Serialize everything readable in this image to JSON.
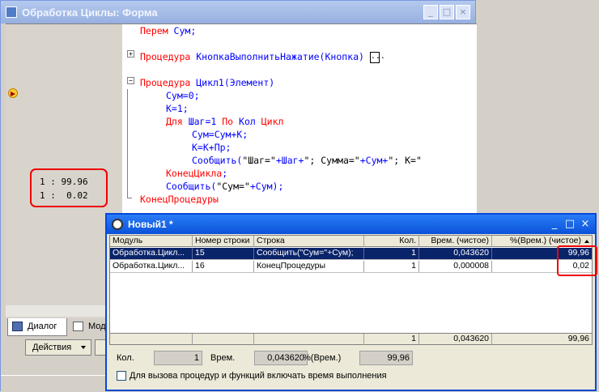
{
  "main_window": {
    "title": "Обработка Циклы: Форма",
    "buttons": {
      "minimize": "_",
      "maximize": "□",
      "close": "×"
    }
  },
  "code": {
    "l1": {
      "kw": "Перем",
      "rest": " Сум;"
    },
    "l2": {
      "kw": "Процедура",
      "rest": " КнопкаВыполнитьНажатие(Кнопка) ",
      "dots": "..."
    },
    "l3": {
      "kw": "Процедура",
      "rest": " Цикл1(Элемент)"
    },
    "l4": "Сум=0;",
    "l5": "К=1;",
    "l6": {
      "kw1": "Для",
      "mid1": " Шаг=1 ",
      "kw2": "По",
      "mid2": " Кол ",
      "kw3": "Цикл"
    },
    "l7": "Сум=Сум+К;",
    "l8": "К=К+Пр;",
    "l9": {
      "fn": "Сообщить(",
      "s1": "\"Шаг=\"",
      "a1": "+Шаг+",
      "s2": "\"; Сумма=\"",
      "a2": "+Сум+",
      "s3": "\"; К=\""
    },
    "l10": {
      "kw": "КонецЦикла",
      "rest": ";"
    },
    "l11": {
      "fn": "Сообщить(",
      "s1": "\"Сум=\"",
      "rest": "+Сум);"
    },
    "l12": {
      "kw": "КонецПроцедуры"
    }
  },
  "result_values": {
    "line1": "1 : 99.96",
    "line2": "1 :  0.02"
  },
  "tabs": {
    "dialog": "Диалог",
    "module": "Модуль"
  },
  "actions_button": "Действия",
  "profile_window": {
    "title": "Новый1 *",
    "buttons": {
      "minimize": "_",
      "maximize": "□",
      "close": "×"
    },
    "columns": [
      "Модуль",
      "Номер строки",
      "Строка",
      "Кол.",
      "Врем. (чистое)",
      "%(Врем.) (чистое)"
    ],
    "rows": [
      [
        "Обработка.Цикл...",
        "15",
        "Сообщить(\"Сум=\"+Сум);",
        "1",
        "0,043620",
        "99,96"
      ],
      [
        "Обработка.Цикл...",
        "16",
        "КонецПроцедуры",
        "1",
        "0,000008",
        "0,02"
      ]
    ],
    "footer": {
      "count": "1",
      "time": "0,043620",
      "percent": "99,96"
    },
    "summary": {
      "count_label": "Кол.",
      "count_value": "1",
      "time_label": "Врем.",
      "time_value": "0,043620",
      "percent_label": "%(Врем.)",
      "percent_value": "99,96"
    },
    "checkbox_label": "Для вызова процедур и функций включать время выполнения",
    "checkbox_checked": false
  },
  "colors": {
    "highlight": "#ee0000",
    "selection": "#0a246a",
    "keyword": "#ff0000",
    "code": "#0000ff"
  }
}
